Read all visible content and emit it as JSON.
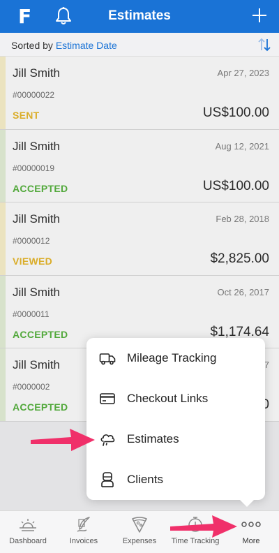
{
  "nav": {
    "logo": "F",
    "title": "Estimates"
  },
  "sortbar": {
    "prefix": "Sorted by",
    "field": "Estimate Date"
  },
  "colors": {
    "accent": "#1a73d6",
    "sent": "#e8b41e",
    "accepted": "#4caf32",
    "viewed": "#e8b41e",
    "arrow": "#f0306a"
  },
  "estimates": [
    {
      "client": "Jill Smith",
      "date": "Apr 27, 2023",
      "number": "#00000022",
      "status": "SENT",
      "amount": "US$100.00"
    },
    {
      "client": "Jill Smith",
      "date": "Aug 12, 2021",
      "number": "#00000019",
      "status": "ACCEPTED",
      "amount": "US$100.00"
    },
    {
      "client": "Jill Smith",
      "date": "Feb 28, 2018",
      "number": "#0000012",
      "status": "VIEWED",
      "amount": "$2,825.00"
    },
    {
      "client": "Jill Smith",
      "date": "Oct 26, 2017",
      "number": "#0000011",
      "status": "ACCEPTED",
      "amount": "$1,174.64"
    },
    {
      "client": "Jill Smith",
      "date": "7",
      "number": "#0000002",
      "status": "ACCEPTED",
      "amount": "0"
    }
  ],
  "more_menu": {
    "items": [
      {
        "label": "Mileage Tracking",
        "icon": "truck-icon"
      },
      {
        "label": "Checkout Links",
        "icon": "credit-card-icon"
      },
      {
        "label": "Estimates",
        "icon": "estimates-cloud-icon"
      },
      {
        "label": "Clients",
        "icon": "client-person-icon"
      }
    ]
  },
  "tabbar": {
    "tabs": [
      {
        "label": "Dashboard",
        "icon": "sunrise-icon"
      },
      {
        "label": "Invoices",
        "icon": "quill-icon"
      },
      {
        "label": "Expenses",
        "icon": "pizza-icon"
      },
      {
        "label": "Time Tracking",
        "icon": "stopwatch-icon"
      },
      {
        "label": "More",
        "icon": "more-dots-icon"
      }
    ]
  }
}
